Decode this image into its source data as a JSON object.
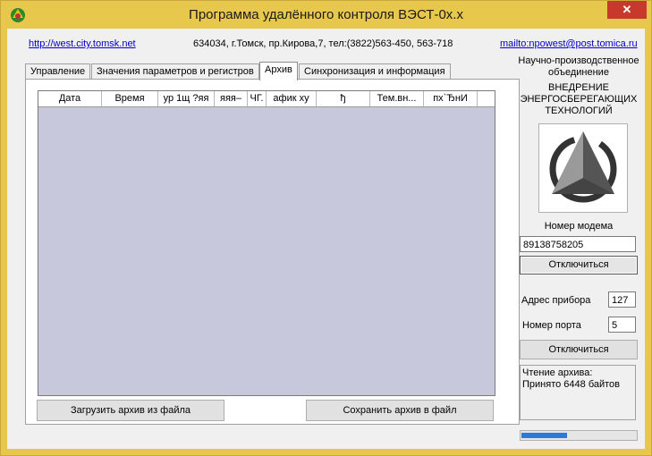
{
  "window": {
    "title": "Программа удалённого контроля ВЭСТ-0х.х",
    "close_label": "✕"
  },
  "header": {
    "site_link": "http://west.city.tomsk.net",
    "address": "634034, г.Томск, пр.Кирова,7, тел:(3822)563-450, 563-718",
    "mail_link": "mailto:npowest@post.tomica.ru"
  },
  "tabs": [
    {
      "label": "Управление"
    },
    {
      "label": "Значения параметров и регистров"
    },
    {
      "label": "Архив"
    },
    {
      "label": "Синхронизация и информация"
    }
  ],
  "archive": {
    "columns": [
      "Дата",
      "Время",
      "ур 1щ ?яя",
      "яяя–",
      "ЧГ.",
      "афик  ху",
      "ђ",
      "Тем.вн...",
      "пх`ЂнИ",
      ""
    ],
    "load_button": "Загрузить архив из файла",
    "save_button": "Сохранить архив в файл"
  },
  "side": {
    "org_line1": "Научно-производственное",
    "org_line2": "объединение",
    "org_line3": "ВНЕДРЕНИЕ",
    "org_line4": "ЭНЕРГОСБЕРЕГАЮЩИХ",
    "org_line5": "ТЕХНОЛОГИЙ",
    "modem_label": "Номер модема",
    "modem_value": "89138758205",
    "disconnect1": "Отключиться",
    "device_addr_label": "Адрес прибора",
    "device_addr_value": "127",
    "port_label": "Номер порта",
    "port_value": "5",
    "disconnect2": "Отключиться",
    "status_line1": "Чтение архива:",
    "status_line2": "Принято 6448 байтов",
    "progress": 0.4
  }
}
